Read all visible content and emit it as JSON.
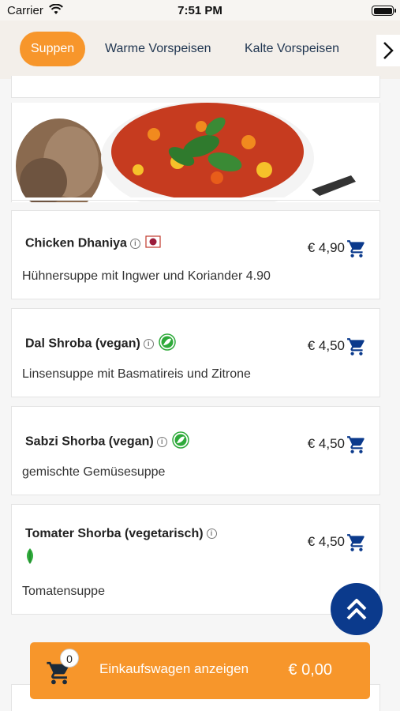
{
  "status_bar": {
    "carrier": "Carrier",
    "time": "7:51 PM"
  },
  "tabs": [
    {
      "label": "Suppen",
      "active": true
    },
    {
      "label": "Warme Vorspeisen",
      "active": false
    },
    {
      "label": "Kalte Vorspeisen",
      "active": false
    }
  ],
  "items": [
    {
      "name": "Chicken Dhaniya",
      "price": "€ 4,90",
      "description": "Hühnersuppe mit Ingwer und Koriander 4.90",
      "badge": "meat-icon"
    },
    {
      "name": "Dal Shroba (vegan)",
      "price": "€ 4,50",
      "description": "Linsensuppe mit Basmatireis und Zitrone",
      "badge": "vegan-icon"
    },
    {
      "name": "Sabzi Shorba (vegan)",
      "price": "€ 4,50",
      "description": "gemischte Gemüsesuppe",
      "badge": "vegan-icon"
    },
    {
      "name": "Tomater Shorba (vegetarisch)",
      "price": "€ 4,50",
      "description": "Tomatensuppe",
      "badge": "vegetarian-leaf-icon"
    }
  ],
  "cart": {
    "count": "0",
    "label": "Einkaufswagen anzeigen",
    "total": "€ 0,00"
  },
  "colors": {
    "accent": "#f7962b",
    "primary": "#0b3a8c",
    "text_dark": "#1f3550"
  }
}
